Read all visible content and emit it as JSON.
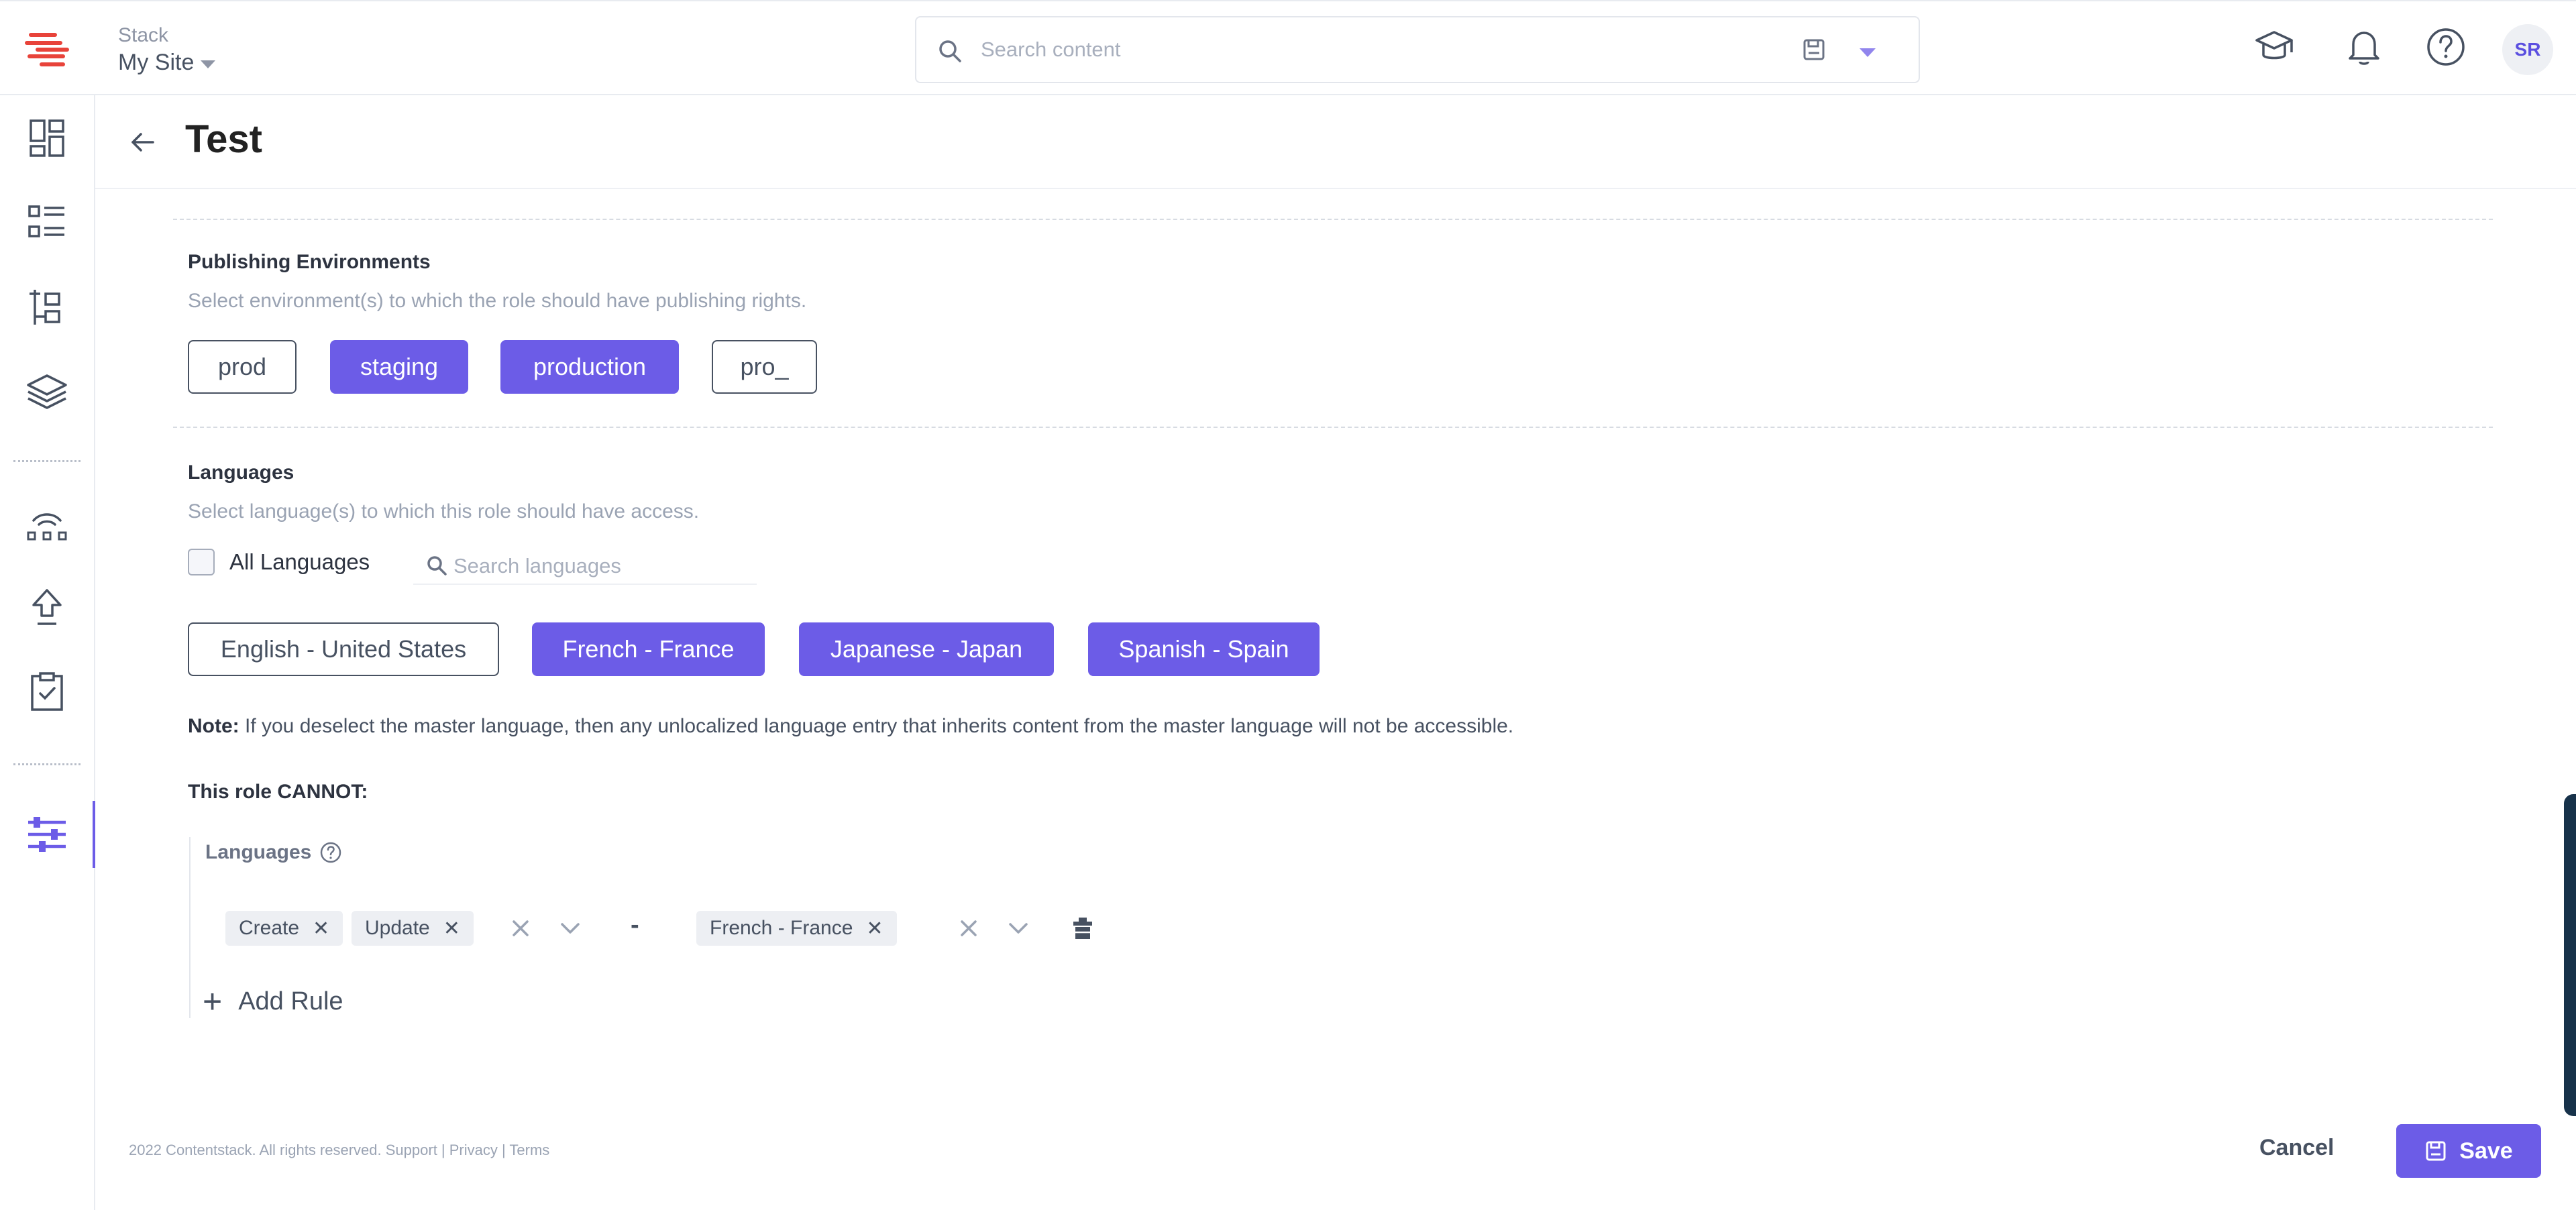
{
  "header": {
    "stack_label": "Stack",
    "site_name": "My Site",
    "search_placeholder": "Search content",
    "avatar_initials": "SR"
  },
  "page": {
    "title": "Test"
  },
  "publishing": {
    "title": "Publishing Environments",
    "subtitle": "Select environment(s) to which the role should have publishing rights.",
    "environments": [
      {
        "label": "prod",
        "selected": false
      },
      {
        "label": "staging",
        "selected": true
      },
      {
        "label": "production",
        "selected": true
      },
      {
        "label": "pro_",
        "selected": false
      }
    ]
  },
  "languages": {
    "title": "Languages",
    "subtitle": "Select language(s) to which this role should have access.",
    "all_label": "All Languages",
    "search_placeholder": "Search languages",
    "items": [
      {
        "label": "English - United States",
        "selected": false
      },
      {
        "label": "French - France",
        "selected": true
      },
      {
        "label": "Japanese - Japan",
        "selected": true
      },
      {
        "label": "Spanish - Spain",
        "selected": true
      }
    ],
    "note_bold": "Note:",
    "note_text": " If you deselect the master language, then any unlocalized language entry that inherits content from the master language will not be accessible."
  },
  "cannot": {
    "title": "This role CANNOT:",
    "rule_label": "Languages",
    "actions": [
      "Create",
      "Update"
    ],
    "separator": "-",
    "targets": [
      "French - France"
    ],
    "add_rule_label": "Add Rule"
  },
  "footer": {
    "copyright": "2022 Contentstack. All rights reserved. Support | Privacy | Terms",
    "cancel_label": "Cancel",
    "save_label": "Save"
  },
  "colors": {
    "accent": "#6c5ce7",
    "text_dark": "#2d3340",
    "text_muted": "#9aa3b3",
    "logo": "#e8433a"
  }
}
